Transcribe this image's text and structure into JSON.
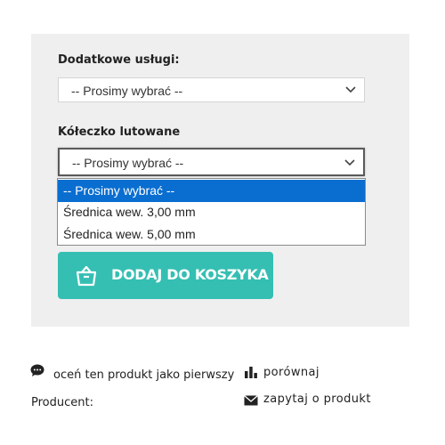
{
  "options_panel": {
    "services": {
      "label": "Dodatkowe usługi:",
      "selected": "-- Prosimy wybrać --",
      "icon": "chevron-down-icon"
    },
    "ring": {
      "label": "Kółeczko lutowane",
      "selected": "-- Prosimy wybrać --",
      "icon": "chevron-down-icon",
      "options": [
        "-- Prosimy wybrać --",
        "Średnica wew. 3,00 mm",
        "Średnica wew. 5,00 mm"
      ]
    },
    "add_to_cart": {
      "label": "DODAJ DO KOSZYKA",
      "icon": "shopping-basket-icon",
      "color": "#35bfb3"
    }
  },
  "product_meta": {
    "review_link": "oceń ten produkt jako pierwszy",
    "producer_label": "Producent:",
    "compare_link": "porównaj",
    "ask_link": "zapytaj o produkt",
    "icons": [
      "comment-icon",
      "bar-chart-icon",
      "envelope-icon"
    ]
  },
  "colors": {
    "panel_bg": "#efefef",
    "highlight": "#0a6ed1"
  }
}
